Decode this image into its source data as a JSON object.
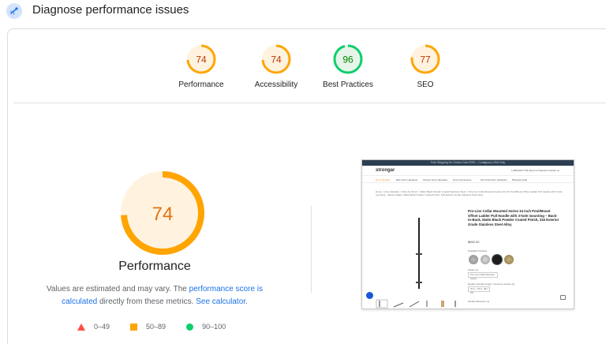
{
  "header": {
    "title": "Diagnose performance issues",
    "icon": "lighthouse-icon",
    "icon_color": "#1a73e8"
  },
  "summary_scores": [
    {
      "label": "Performance",
      "score": "74",
      "rating": "average",
      "color": "#ffa400",
      "bg": "#fff3e0",
      "text_color": "#c33300"
    },
    {
      "label": "Accessibility",
      "score": "74",
      "rating": "average",
      "color": "#ffa400",
      "bg": "#fff3e0",
      "text_color": "#c33300"
    },
    {
      "label": "Best Practices",
      "score": "96",
      "rating": "pass",
      "color": "#0cce6b",
      "bg": "#e6f4ea",
      "text_color": "#008800"
    },
    {
      "label": "SEO",
      "score": "77",
      "rating": "average",
      "color": "#ffa400",
      "bg": "#fff3e0",
      "text_color": "#c33300"
    }
  ],
  "performance": {
    "score": "74",
    "title": "Performance",
    "color": "#ffa400",
    "desc_prefix": "Values are estimated and may vary. The ",
    "desc_link1": "performance score is calculated",
    "desc_middle": " directly from these metrics. ",
    "desc_link2": "See calculator",
    "desc_suffix": "."
  },
  "legend": [
    {
      "shape": "triangle",
      "range": "0–49",
      "color": "#ff4e42"
    },
    {
      "shape": "square",
      "range": "50–89",
      "color": "#ffa400"
    },
    {
      "shape": "circle",
      "range": "90–100",
      "color": "#0cce6b"
    }
  ],
  "screenshot": {
    "top_banner": "Free Shipping On Orders Over $750 – Contiguous USA Only",
    "logo": "strongar",
    "header_links": "1-888-406-7734     About us     Request     Contact us",
    "menu": [
      "Door Handles",
      "Barn Door Hardware",
      "Shower Door Hardware",
      "Door Accessories",
      "Pet Flush Door Hardware",
      "Brands/Locals"
    ],
    "breadcrumb": "Home  >  Door Handles  >  Shop by Finish  >  Matte Black Powder Coated Stainless Steel  >  Pro-Line Collar Mounted Series 34 inch Pool/Mount Offset Ladder Pull Handle with 3-hole mounting – Back-to-Back, Matte Black Powder Coated Finish, 316 Exterior Grade Stainless Steel Alloy",
    "product_title": "Pro-Line Collar Mounted Series 34 inch Pool/Mount Offset Ladder Pull Handle with 3-hole mounting – Back-to-Back, Matte Black Powder Coated Finish, 316 Exterior Grade Stainless Steel Alloy",
    "price": "$652.00",
    "finish_label": "Available Finishes",
    "option1_label": "Option (1)",
    "option1_value": "Pro-Line Collar Mounted Series",
    "option2_label": "Handle Overall Length / Center-to-Center (1)",
    "option2_value": "34 in. / 30 in. (86 / 76)",
    "option3_label": "Handle Diameter (1)"
  }
}
